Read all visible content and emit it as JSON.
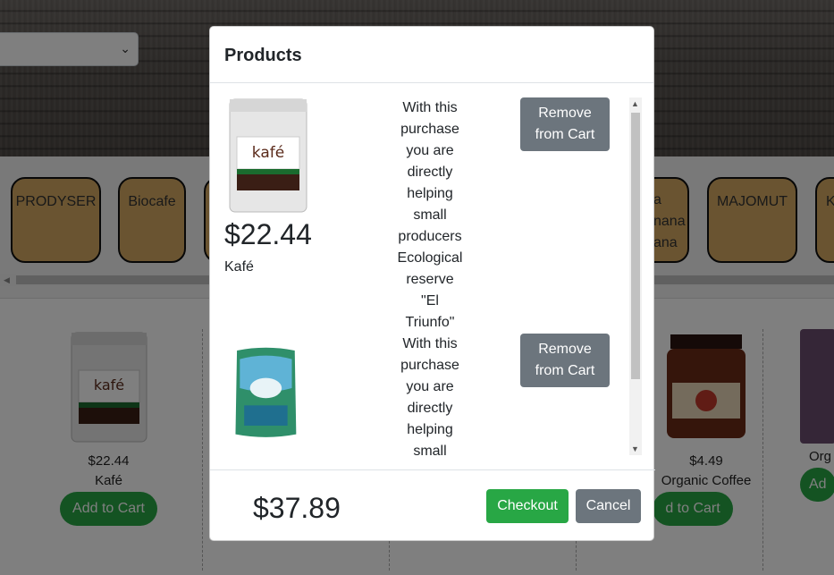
{
  "modal": {
    "title": "Products",
    "items": [
      {
        "price": "$22.44",
        "name": "Kafé",
        "description_lines": [
          "With this",
          "purchase",
          "you are",
          "directly",
          "helping",
          "small",
          "producers",
          "Ecological",
          "reserve \"El",
          "Triunfo\""
        ],
        "remove_label_1": "Remove",
        "remove_label_2": "from Cart",
        "image_icon": "coffee-bag-kafe"
      },
      {
        "price": "",
        "name": "",
        "description_lines": [
          "With this",
          "purchase",
          "you are",
          "directly",
          "helping",
          "small"
        ],
        "remove_label_1": "Remove",
        "remove_label_2": "from Cart",
        "image_icon": "coffee-bag-green"
      }
    ],
    "total": "$37.89",
    "checkout_label": "Checkout",
    "cancel_label": "Cancel"
  },
  "brands": [
    "PRODYSER",
    "Biocafe",
    "",
    "La\nlana\nana",
    "MAJOMUT",
    "K"
  ],
  "brand_labels": {
    "b1": "PRODYSER",
    "b2": "Biocafe",
    "b4_l1": "a",
    "b4_l2": "nana",
    "b4_l3": "ana",
    "b5": "MAJOMUT",
    "b6": "K"
  },
  "products": [
    {
      "price": "$22.44",
      "name": "Kafé",
      "button": "Add to Cart"
    },
    {
      "price": "$4.49",
      "name": "Organic Coffee",
      "button": "d to Cart"
    },
    {
      "price": "",
      "name": "Org",
      "button": "Ad"
    }
  ],
  "colors": {
    "brand_card": "#d4a962",
    "success": "#28a745",
    "secondary": "#6c757d"
  }
}
